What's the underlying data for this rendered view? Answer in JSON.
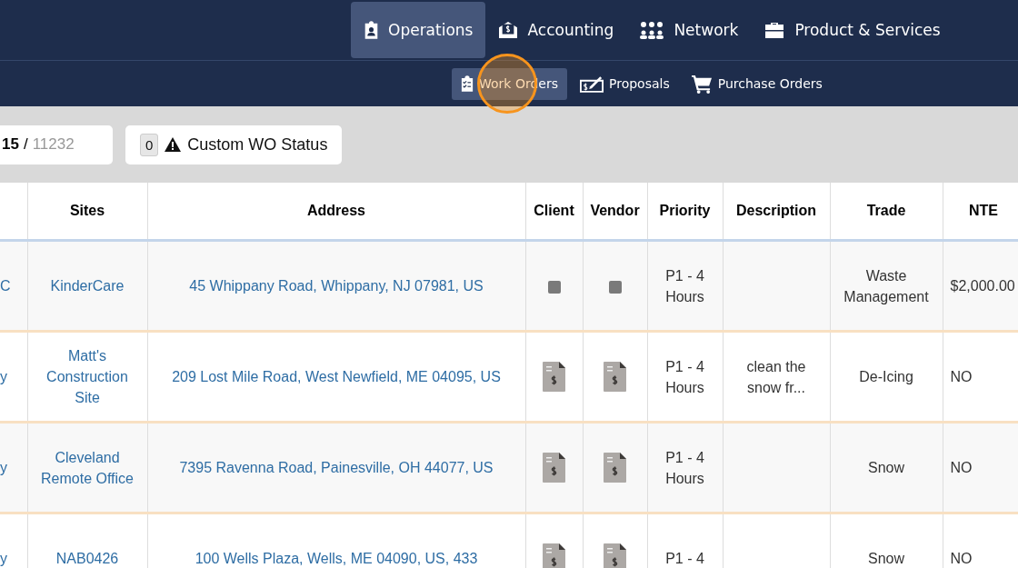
{
  "main_nav": [
    {
      "label": "Operations",
      "selected": true
    },
    {
      "label": "Accounting",
      "selected": false
    },
    {
      "label": "Network",
      "selected": false
    },
    {
      "label": "Product & Services",
      "selected": false
    }
  ],
  "sub_nav": [
    {
      "label": "Work Orders",
      "selected": true,
      "clicked": true
    },
    {
      "label": "Proposals",
      "selected": false,
      "clicked": false
    },
    {
      "label": "Purchase Orders",
      "selected": false,
      "clicked": false
    }
  ],
  "counter": {
    "current": "15",
    "separator": "/",
    "total": "11232"
  },
  "status_filter": {
    "count": "0",
    "label": "Custom WO Status"
  },
  "table": {
    "columns": [
      "",
      "Sites",
      "Address",
      "Client",
      "Vendor",
      "Priority",
      "Description",
      "Trade",
      "NTE"
    ],
    "rows": [
      {
        "column_1": "C",
        "site": "KinderCare",
        "address": "45 Whippany Road, Whippany, NJ 07981, US",
        "client": {
          "kind": "square"
        },
        "vendor": {
          "kind": "square"
        },
        "priority": "P1 - 4 Hours",
        "description": "",
        "trade": "Waste Management",
        "nte": "$2,000.00"
      },
      {
        "column_1": "y",
        "site": "Matt's Construction Site",
        "address": "209 Lost Mile Road, West Newfield, ME 04095, US",
        "client": {
          "kind": "invoice"
        },
        "vendor": {
          "kind": "invoice"
        },
        "priority": "P1 - 4 Hours",
        "description": "clean the snow fr...",
        "trade": "De-Icing",
        "nte": "NO"
      },
      {
        "column_1": "y",
        "site": "Cleveland Remote Office",
        "address": "7395 Ravenna Road, Painesville, OH 44077, US",
        "client": {
          "kind": "invoice"
        },
        "vendor": {
          "kind": "invoice"
        },
        "priority": "P1 - 4 Hours",
        "description": "",
        "trade": "Snow",
        "nte": "NO"
      },
      {
        "column_1": "y",
        "site": "NAB0426",
        "address": "100 Wells Plaza, Wells, ME 04090, US, 433",
        "client": {
          "kind": "invoice"
        },
        "vendor": {
          "kind": "invoice"
        },
        "priority": "P1 - 4",
        "description": "",
        "trade": "Snow",
        "nte": "NO"
      }
    ]
  }
}
